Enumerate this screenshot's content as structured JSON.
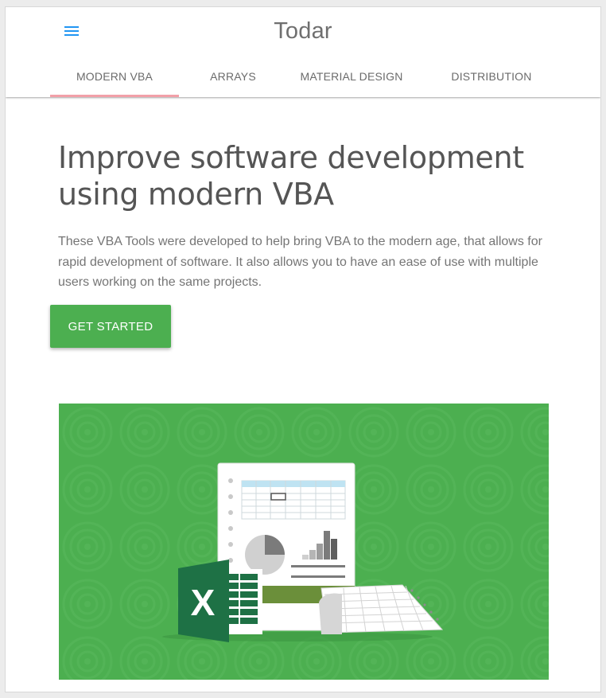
{
  "header": {
    "title": "Todar",
    "menu_icon": "menu-icon"
  },
  "tabs": [
    {
      "label": "MODERN VBA",
      "active": true
    },
    {
      "label": "ARRAYS",
      "active": false
    },
    {
      "label": "MATERIAL DESIGN",
      "active": false
    },
    {
      "label": "DISTRIBUTION",
      "active": false
    }
  ],
  "hero": {
    "title_line1": "Improve software development",
    "title_line2": "using modern VBA",
    "description": "These VBA Tools were developed to help bring VBA to the modern age, that allows for rapid development of software. It also allows you to have an ease of use with multiple users working on the same projects.",
    "cta_label": "GET STARTED"
  },
  "banner": {
    "logo_letter": "X",
    "image_icon": "excel-spreadsheet-illustration"
  },
  "colors": {
    "accent_green": "#4caf50",
    "tab_indicator": "#f2a0a8",
    "menu_blue": "#2196f3",
    "excel_green": "#1e7145"
  }
}
